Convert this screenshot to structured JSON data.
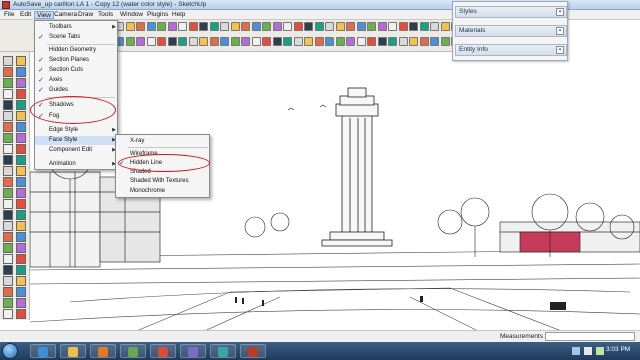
{
  "window": {
    "title": "AutoSave_up carillon LA 1 - Copy 12 (water color style) - SketchUp"
  },
  "menubar": {
    "items": [
      "File",
      "Edit",
      "View",
      "Camera",
      "Draw",
      "Tools",
      "Window",
      "Plugins",
      "Help"
    ],
    "active": "View"
  },
  "view_menu": {
    "items": [
      {
        "label": "Toolbars",
        "checked": false,
        "submenu": true
      },
      {
        "label": "Scene Tabs",
        "checked": true,
        "submenu": false
      },
      {
        "label": "Hidden Geometry",
        "checked": false,
        "submenu": false
      },
      {
        "label": "Section Planes",
        "checked": true,
        "submenu": false
      },
      {
        "label": "Section Cuts",
        "checked": true,
        "submenu": false
      },
      {
        "label": "Axes",
        "checked": true,
        "submenu": false
      },
      {
        "label": "Guides",
        "checked": true,
        "submenu": false
      },
      {
        "label": "Shadows",
        "checked": true,
        "submenu": false
      },
      {
        "label": "Fog",
        "checked": true,
        "submenu": false
      },
      {
        "label": "Edge Style",
        "checked": false,
        "submenu": true
      },
      {
        "label": "Face Style",
        "checked": false,
        "submenu": true
      },
      {
        "label": "Component Edit",
        "checked": false,
        "submenu": true
      },
      {
        "label": "Animation",
        "checked": false,
        "submenu": true
      }
    ]
  },
  "face_style_menu": {
    "items": [
      {
        "label": "X-ray",
        "checked": false
      },
      {
        "label": "Wireframe",
        "checked": false
      },
      {
        "label": "Hidden Line",
        "checked": true
      },
      {
        "label": "Shaded",
        "checked": false
      },
      {
        "label": "Shaded With Textures",
        "checked": false
      },
      {
        "label": "Monochrome",
        "checked": false
      }
    ]
  },
  "tray": {
    "panels": [
      "Styles",
      "Materials",
      "Entity Info"
    ]
  },
  "statusbar": {
    "measurements_label": "Measurements",
    "measurements_value": ""
  },
  "taskbar": {
    "clock": "3:03 PM"
  },
  "colors": {
    "highlight_ring": "#d21a1a",
    "titlebar": "#c9dcf3",
    "taskbar": "#1f3b5c"
  }
}
